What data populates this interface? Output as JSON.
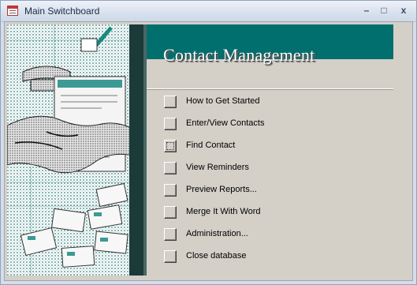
{
  "window": {
    "title": "Main Switchboard",
    "controls": {
      "minimize": "–",
      "maximize": "□",
      "close": "x"
    }
  },
  "switchboard": {
    "heading": "Contact Management",
    "banner_color": "#006f6d",
    "items": [
      {
        "label": "How to Get Started"
      },
      {
        "label": "Enter/View Contacts"
      },
      {
        "label": "Find Contact"
      },
      {
        "label": "View Reminders"
      },
      {
        "label": "Preview Reports..."
      },
      {
        "label": "Merge It With Word"
      },
      {
        "label": "Administration..."
      },
      {
        "label": "Close database"
      }
    ]
  }
}
